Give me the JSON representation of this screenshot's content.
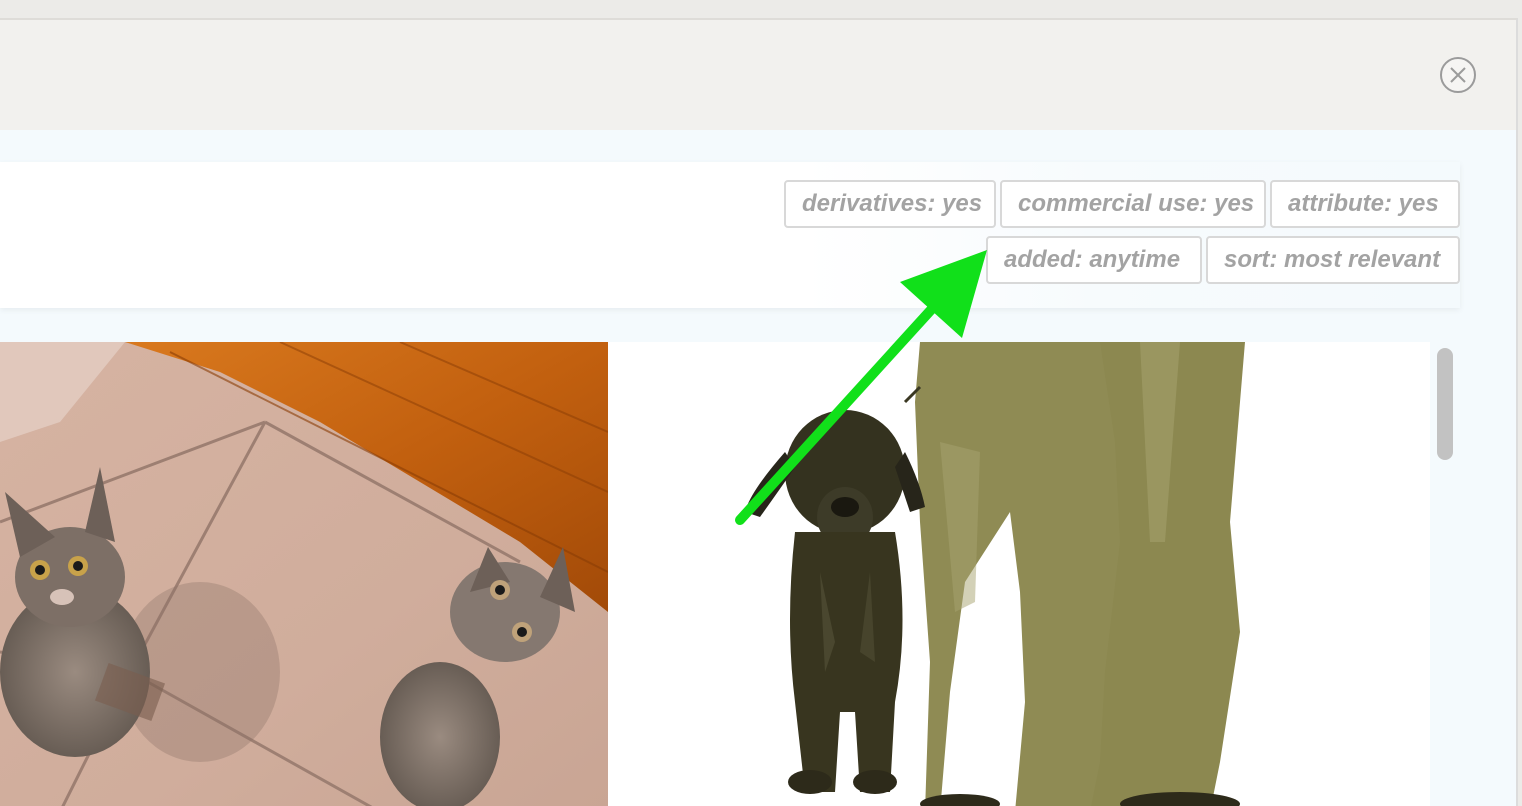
{
  "modal": {
    "close_icon": "close-icon"
  },
  "filters": {
    "row1": [
      {
        "label": "derivatives: yes"
      },
      {
        "label": "commercial use: yes"
      },
      {
        "label": "attribute: yes"
      }
    ],
    "row2": [
      {
        "label": "added: anytime"
      },
      {
        "label": "sort: most relevant"
      }
    ]
  },
  "results": {
    "images": [
      {
        "subject": "two-kittens-on-tile-floor"
      },
      {
        "subject": "dog-beside-person-in-jeans"
      }
    ]
  },
  "colors": {
    "chip_text": "#a3a3a3",
    "chip_border": "#d8d8d8",
    "annotation_arrow": "#11e01a"
  }
}
